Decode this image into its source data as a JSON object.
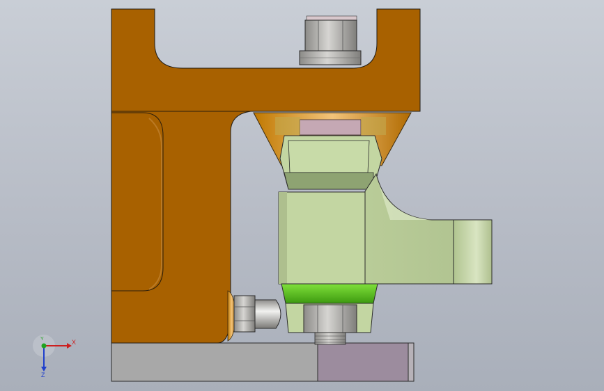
{
  "view": {
    "background": "#b9bec8",
    "part_colors": {
      "bracket": "#a86100",
      "bracket_outline": "#1e1a14",
      "clamp_body": "#c3d6a2",
      "clamp_shadow": "#9fb584",
      "bolt_steel": "#aaa9a6",
      "spring_ring": "#58c21e",
      "base_plate": "#a8a8a8",
      "base_insert": "#9c8c9e",
      "washer_pink": "#c5a8b4"
    }
  },
  "triad": {
    "x_label": "X",
    "y_label": "Y",
    "z_label": "Z",
    "x_color": "#cc1f1f",
    "y_color": "#1fa31f",
    "z_color": "#1f3fcc"
  }
}
